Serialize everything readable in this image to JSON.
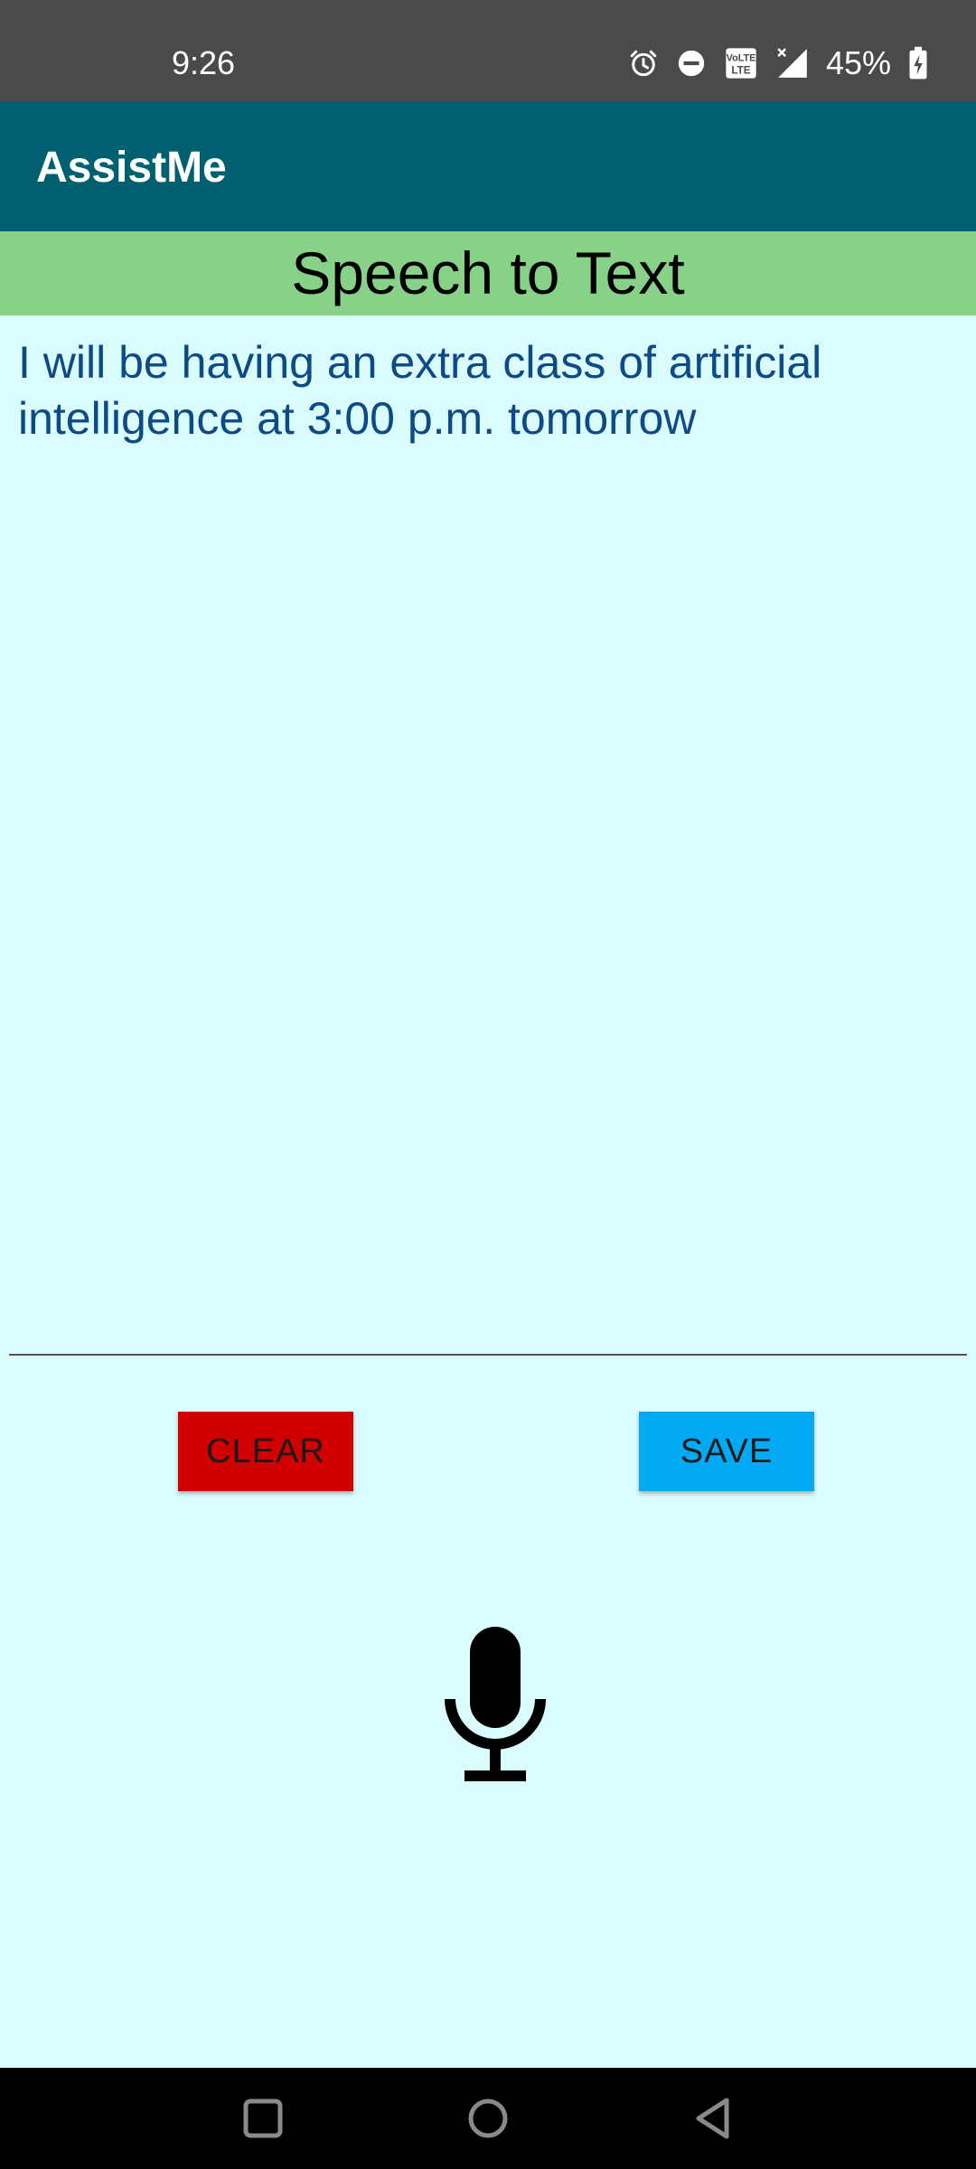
{
  "status_bar": {
    "time": "9:26",
    "battery_percent": "45%",
    "network_badge": "VoLTE",
    "icons": [
      "alarm-icon",
      "do-not-disturb-icon",
      "volte-icon",
      "signal-icon",
      "battery-charging-icon"
    ]
  },
  "app_bar": {
    "title": "AssistMe"
  },
  "heading": "Speech to Text",
  "transcript": "I will be having an extra class of artificial intelligence at 3:00 p.m. tomorrow",
  "buttons": {
    "clear_label": "CLEAR",
    "save_label": "SAVE"
  },
  "mic": {
    "icon": "microphone-icon"
  },
  "nav_bar": {
    "icons": [
      "recents-icon",
      "home-icon",
      "back-icon"
    ]
  },
  "colors": {
    "status_bar": "#4a4a4a",
    "app_bar": "#006070",
    "heading_band": "#88d188",
    "background": "#dafcfd",
    "transcript_text": "#0d4a86",
    "clear_button": "#d10000",
    "save_button": "#03a9f4"
  }
}
